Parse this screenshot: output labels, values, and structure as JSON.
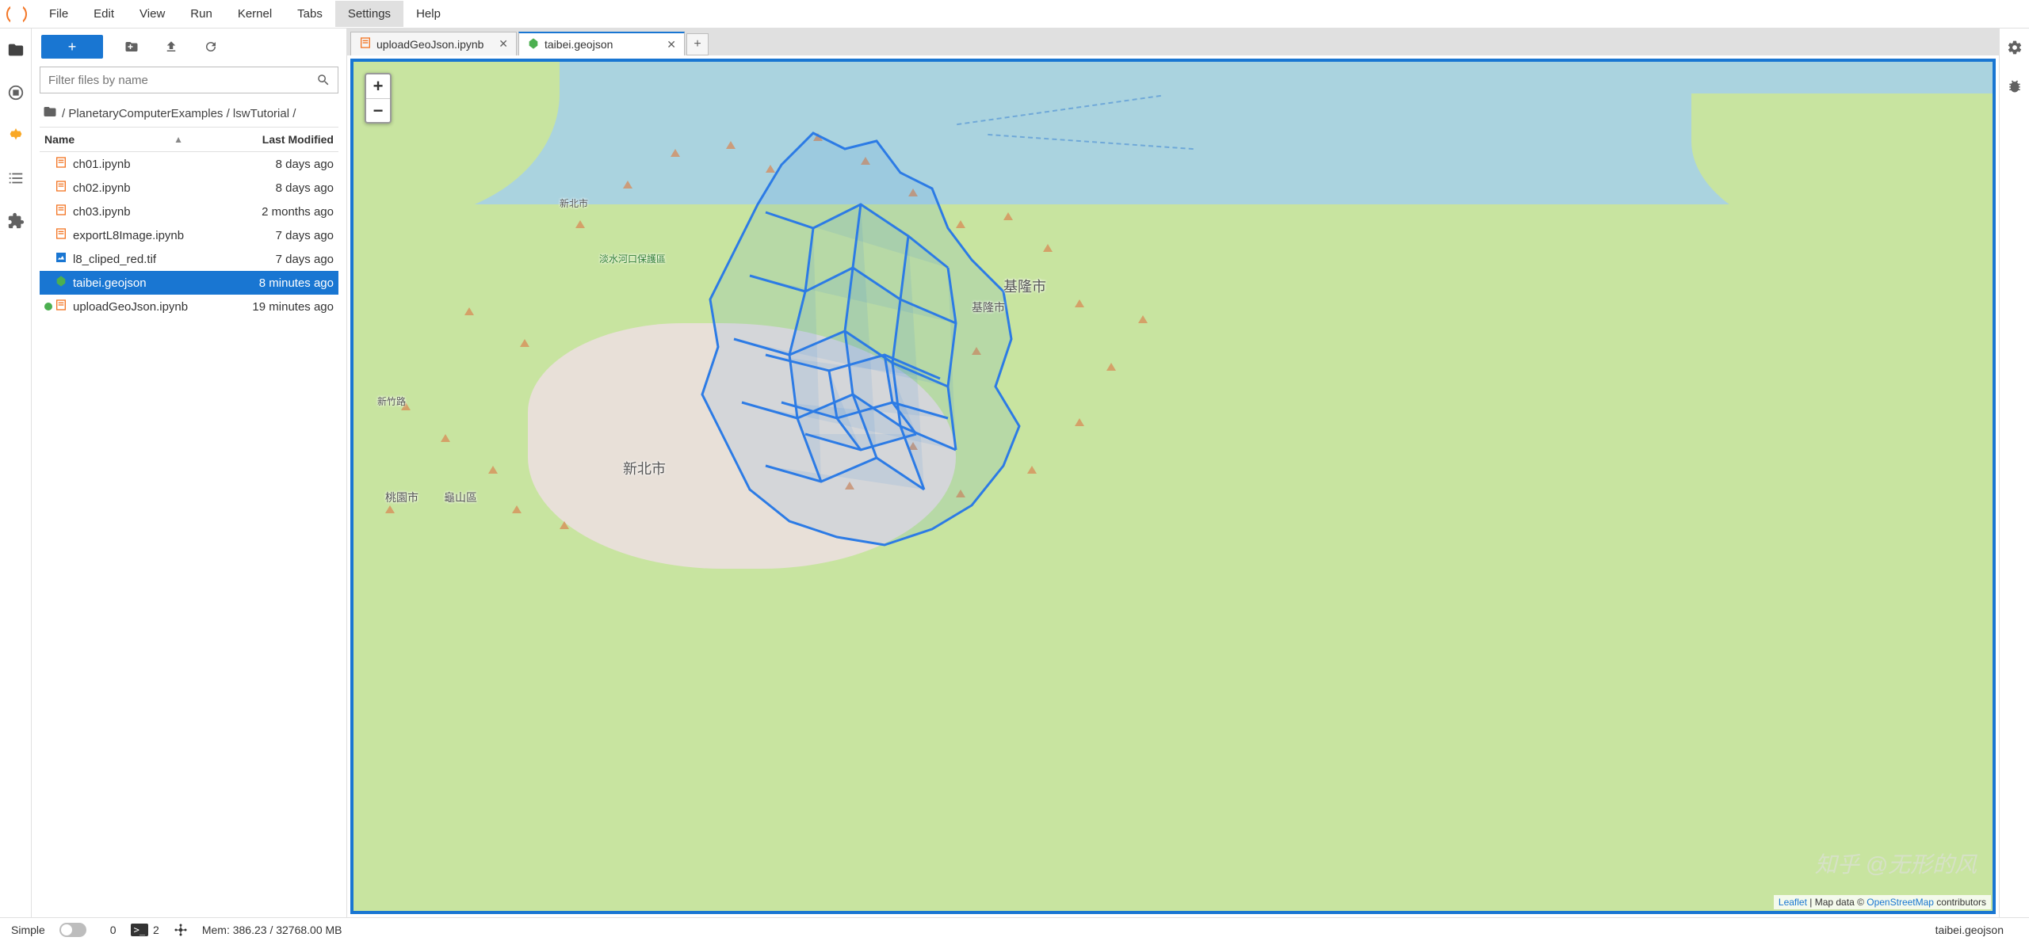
{
  "menubar": {
    "items": [
      "File",
      "Edit",
      "View",
      "Run",
      "Kernel",
      "Tabs",
      "Settings",
      "Help"
    ],
    "active_index": 6
  },
  "filebrowser": {
    "filter_placeholder": "Filter files by name",
    "breadcrumb": "/ PlanetaryComputerExamples / lswTutorial /",
    "columns": {
      "name": "Name",
      "modified": "Last Modified"
    },
    "files": [
      {
        "name": "ch01.ipynb",
        "modified": "8 days ago",
        "icon": "notebook",
        "running": false,
        "selected": false
      },
      {
        "name": "ch02.ipynb",
        "modified": "8 days ago",
        "icon": "notebook",
        "running": false,
        "selected": false
      },
      {
        "name": "ch03.ipynb",
        "modified": "2 months ago",
        "icon": "notebook",
        "running": false,
        "selected": false
      },
      {
        "name": "exportL8Image.ipynb",
        "modified": "7 days ago",
        "icon": "notebook",
        "running": false,
        "selected": false
      },
      {
        "name": "l8_cliped_red.tif",
        "modified": "7 days ago",
        "icon": "tif",
        "running": false,
        "selected": false
      },
      {
        "name": "taibei.geojson",
        "modified": "8 minutes ago",
        "icon": "geojson",
        "running": false,
        "selected": true
      },
      {
        "name": "uploadGeoJson.ipynb",
        "modified": "19 minutes ago",
        "icon": "notebook",
        "running": true,
        "selected": false
      }
    ]
  },
  "tabs": [
    {
      "label": "uploadGeoJson.ipynb",
      "icon": "notebook",
      "active": false
    },
    {
      "label": "taibei.geojson",
      "icon": "geojson",
      "active": true
    }
  ],
  "map": {
    "zoom_in": "+",
    "zoom_out": "−",
    "labels": {
      "xinbei": "新北市",
      "taoyuan": "桃園市",
      "guishan": "龜山區",
      "jilong": "基隆市",
      "jilong2": "基隆市",
      "xinzhu": "新竹路",
      "danshui": "淡水河口保護區",
      "xinbei_north": "新北市"
    },
    "attribution_prefix": "Leaflet",
    "attribution_text": " | Map data © ",
    "attribution_link": "OpenStreetMap",
    "attribution_suffix": " contributors"
  },
  "statusbar": {
    "mode": "Simple",
    "kernel_count": "0",
    "terminal_count": "2",
    "memory": "Mem: 386.23 / 32768.00 MB",
    "context": "taibei.geojson"
  },
  "watermark": "知乎 @无形的风"
}
